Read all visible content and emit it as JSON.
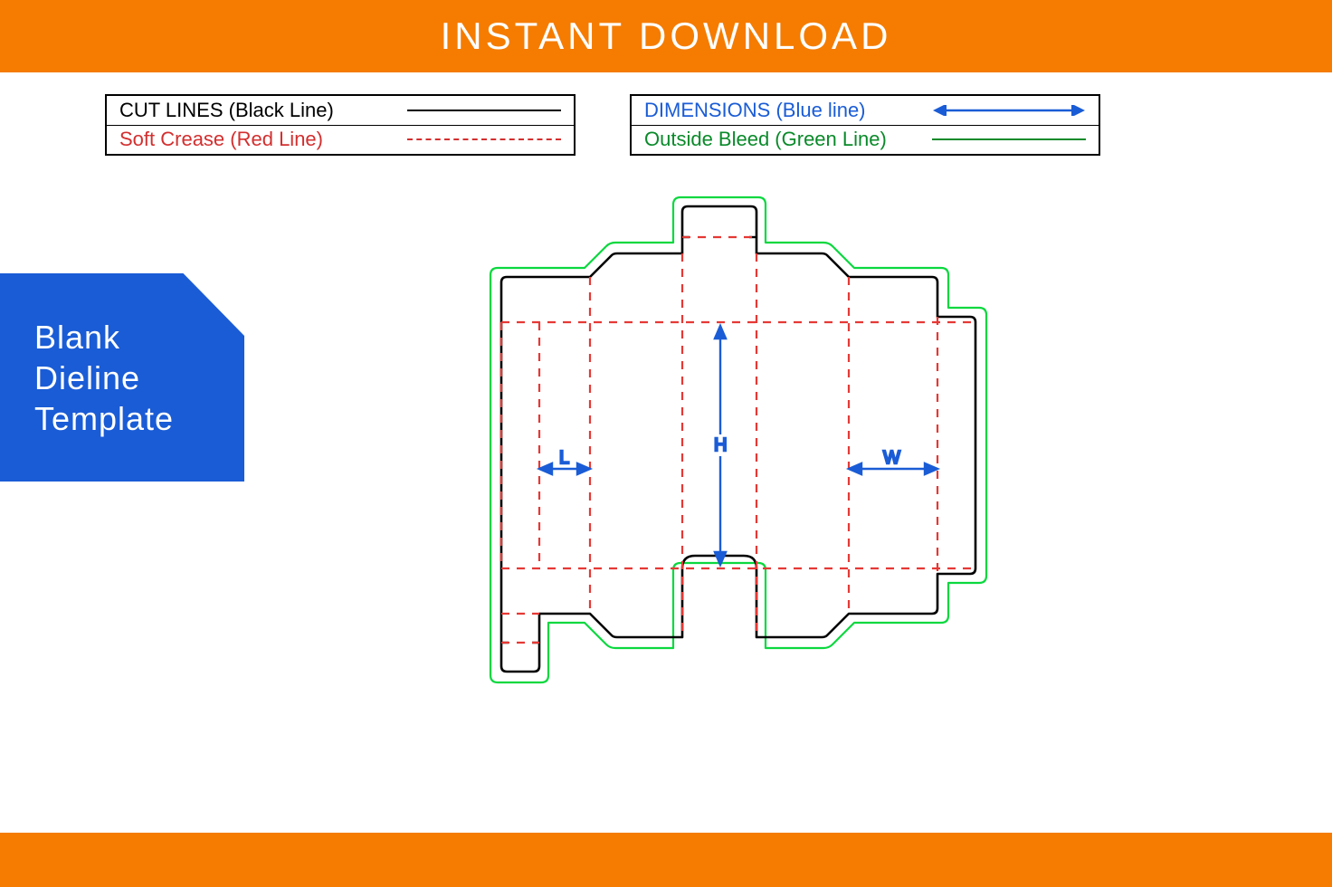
{
  "banner": {
    "title": "INSTANT DOWNLOAD"
  },
  "legend": {
    "left": [
      {
        "label": "CUT LINES (Black Line)",
        "class": "cl-black",
        "line": "solid"
      },
      {
        "label": "Soft Crease (Red Line)",
        "class": "cl-red",
        "line": "dash"
      }
    ],
    "right": [
      {
        "label": "DIMENSIONS (Blue line)",
        "class": "cl-blue",
        "line": "arrow"
      },
      {
        "label": "Outside Bleed (Green Line)",
        "class": "cl-green",
        "line": "green"
      }
    ]
  },
  "badge": {
    "line1": "Blank",
    "line2": "Dieline",
    "line3": "Template"
  },
  "dims": {
    "L": "L",
    "H": "H",
    "W": "W"
  }
}
